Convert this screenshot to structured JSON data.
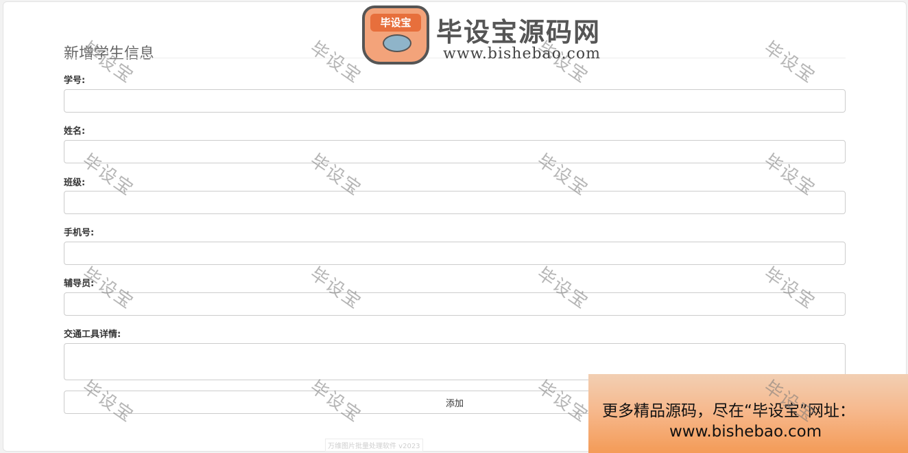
{
  "form": {
    "title": "新增学生信息",
    "fields": [
      {
        "label": "学号:",
        "value": "",
        "placeholder": ""
      },
      {
        "label": "姓名:",
        "value": "",
        "placeholder": ""
      },
      {
        "label": "班级:",
        "value": "",
        "placeholder": ""
      },
      {
        "label": "手机号:",
        "value": "",
        "placeholder": ""
      },
      {
        "label": "辅导员:",
        "value": "",
        "placeholder": ""
      },
      {
        "label": "交通工具详情:",
        "value": "",
        "placeholder": ""
      }
    ],
    "submit_label": "添加",
    "footer_note": "万维图片批量处理软件 v2023"
  },
  "watermark": {
    "text": "毕设宝"
  },
  "brand": {
    "badge_text": "毕设宝",
    "name": "毕设宝源码网",
    "url": "www.bishebao.com"
  },
  "promo": {
    "line1": "更多精品源码，尽在“毕设宝”网址：",
    "line2": "www.bishebao.com"
  }
}
